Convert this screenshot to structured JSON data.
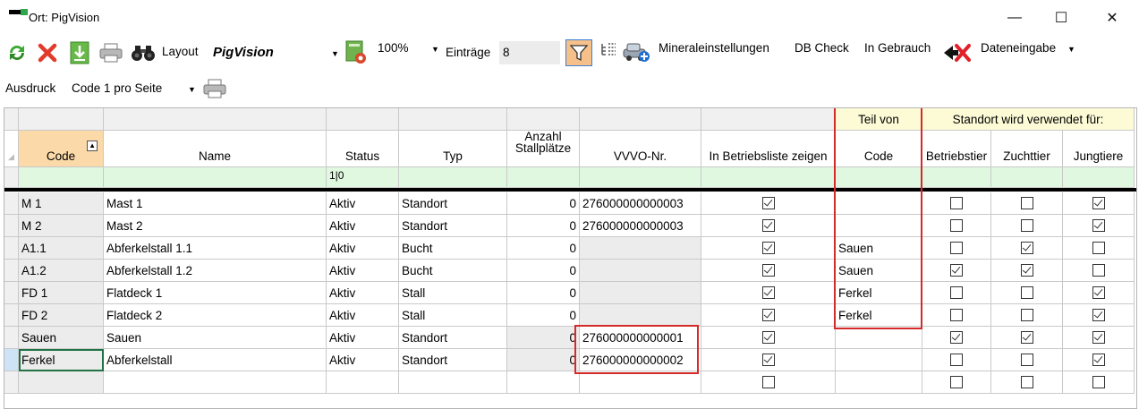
{
  "window": {
    "title": "Ort: PigVision",
    "minimize": "—",
    "maximize": "☐",
    "close": "✕"
  },
  "toolbar": {
    "layout_label": "Layout",
    "layout_value": "PigVision",
    "zoom_value": "100%",
    "entries_label": "Einträge",
    "entries_value": "8",
    "mineral_label": "Mineraleinstellungen",
    "dbcheck_label": "DB Check",
    "inuse_label": "In Gebrauch",
    "dataentry_label": "Dateneingabe",
    "print_label": "Ausdruck",
    "print_value": "Code 1 pro Seite"
  },
  "colors": {
    "filter_active_bg": "#f5c08a",
    "group_header_bg": "#fdfbd6",
    "filter_row_bg": "#e0f8e0",
    "highlight_red": "#d42a2a",
    "selection_green": "#217346"
  },
  "grid": {
    "group_headers": {
      "part_of": "Teil von",
      "location_used_for": "Standort wird verwendet für:"
    },
    "columns": {
      "code": "Code",
      "name": "Name",
      "status": "Status",
      "typ": "Typ",
      "stallplaetze_1": "Anzahl",
      "stallplaetze_2": "Stallplätze",
      "vvvo": "VVVO-Nr.",
      "betriebsliste": "In Betriebsliste zeigen",
      "teil_code": "Code",
      "betriebstier": "Betriebstier",
      "zuchttier": "Zuchttier",
      "jungtiere": "Jungtiere"
    },
    "filter_status": "1|0",
    "rows": [
      {
        "code": "M 1",
        "name": "Mast 1",
        "status": "Aktiv",
        "typ": "Standort",
        "plaetze": "0",
        "vvvo": "276000000000003",
        "betriebsliste": true,
        "teil": "",
        "betriebstier": false,
        "zuchttier": false,
        "jungtiere": true
      },
      {
        "code": "M 2",
        "name": "Mast 2",
        "status": "Aktiv",
        "typ": "Standort",
        "plaetze": "0",
        "vvvo": "276000000000003",
        "betriebsliste": true,
        "teil": "",
        "betriebstier": false,
        "zuchttier": false,
        "jungtiere": true
      },
      {
        "code": "A1.1",
        "name": "Abferkelstall 1.1",
        "status": "Aktiv",
        "typ": "Bucht",
        "plaetze": "0",
        "vvvo": "",
        "betriebsliste": true,
        "teil": "Sauen",
        "betriebstier": false,
        "zuchttier": true,
        "jungtiere": false
      },
      {
        "code": "A1.2",
        "name": "Abferkelstall 1.2",
        "status": "Aktiv",
        "typ": "Bucht",
        "plaetze": "0",
        "vvvo": "",
        "betriebsliste": true,
        "teil": "Sauen",
        "betriebstier": true,
        "zuchttier": true,
        "jungtiere": false
      },
      {
        "code": "FD 1",
        "name": "Flatdeck 1",
        "status": "Aktiv",
        "typ": "Stall",
        "plaetze": "0",
        "vvvo": "",
        "betriebsliste": true,
        "teil": "Ferkel",
        "betriebstier": false,
        "zuchttier": false,
        "jungtiere": true
      },
      {
        "code": "FD 2",
        "name": "Flatdeck 2",
        "status": "Aktiv",
        "typ": "Stall",
        "plaetze": "0",
        "vvvo": "",
        "betriebsliste": true,
        "teil": "Ferkel",
        "betriebstier": false,
        "zuchttier": false,
        "jungtiere": true
      },
      {
        "code": "Sauen",
        "name": "Sauen",
        "status": "Aktiv",
        "typ": "Standort",
        "plaetze": "0",
        "vvvo": "276000000000001",
        "betriebsliste": true,
        "teil": "",
        "betriebstier": true,
        "zuchttier": true,
        "jungtiere": true
      },
      {
        "code": "Ferkel",
        "name": "Abferkelstall",
        "status": "Aktiv",
        "typ": "Standort",
        "plaetze": "0",
        "vvvo": "276000000000002",
        "betriebsliste": true,
        "teil": "",
        "betriebstier": false,
        "zuchttier": false,
        "jungtiere": true
      }
    ],
    "new_row": {
      "betriebsliste": false,
      "betriebstier": false,
      "zuchttier": false,
      "jungtiere": false
    }
  }
}
